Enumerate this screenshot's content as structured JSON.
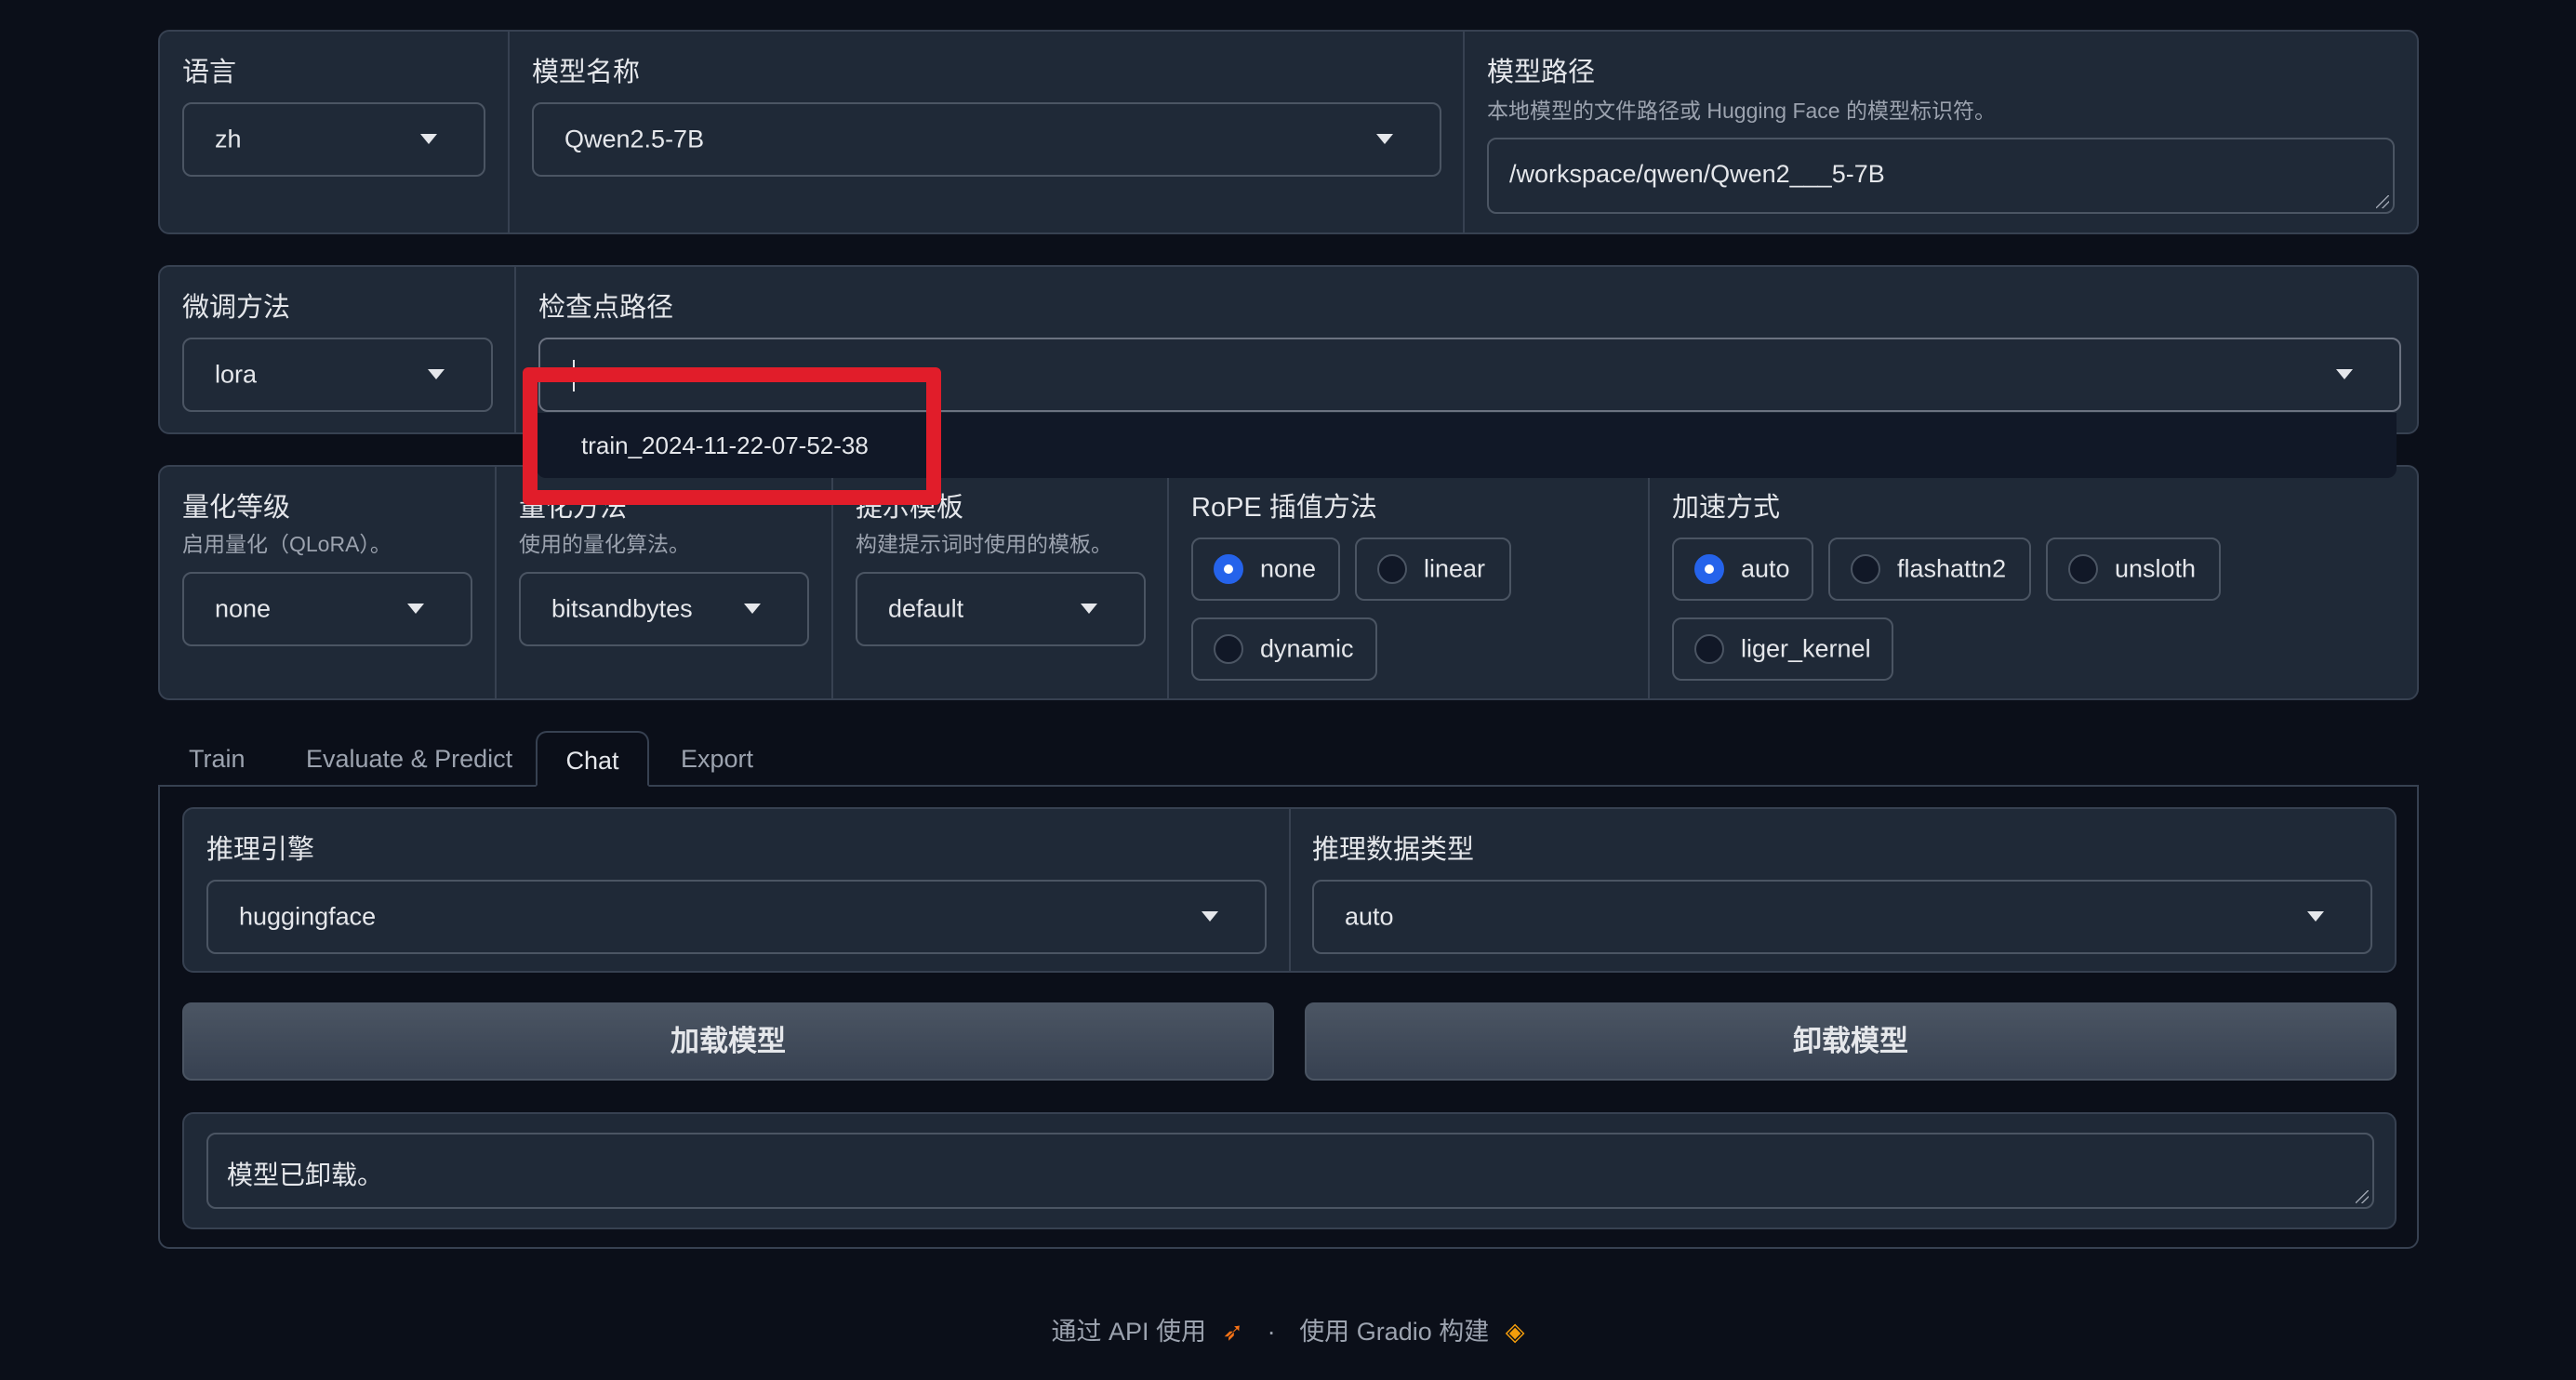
{
  "row1": {
    "lang": {
      "label": "语言",
      "value": "zh"
    },
    "model_name": {
      "label": "模型名称",
      "value": "Qwen2.5-7B"
    },
    "model_path": {
      "label": "模型路径",
      "info": "本地模型的文件路径或 Hugging Face 的模型标识符。",
      "value": "/workspace/qwen/Qwen2___5-7B"
    }
  },
  "row2": {
    "finetune": {
      "label": "微调方法",
      "value": "lora"
    },
    "checkpoint": {
      "label": "检查点路径",
      "value": "",
      "options": [
        "train_2024-11-22-07-52-38"
      ]
    }
  },
  "row3": {
    "quant_bit": {
      "label": "量化等级",
      "info": "启用量化（QLoRA）。",
      "value": "none"
    },
    "quant_method": {
      "label": "量化方法",
      "info": "使用的量化算法。",
      "value": "bitsandbytes"
    },
    "template": {
      "label": "提示模板",
      "info": "构建提示词时使用的模板。",
      "value": "default"
    },
    "rope": {
      "label": "RoPE 插值方法",
      "options": [
        "none",
        "linear",
        "dynamic"
      ],
      "selected": "none"
    },
    "booster": {
      "label": "加速方式",
      "options": [
        "auto",
        "flashattn2",
        "unsloth",
        "liger_kernel"
      ],
      "selected": "auto"
    }
  },
  "tabs": [
    "Train",
    "Evaluate & Predict",
    "Chat",
    "Export"
  ],
  "active_tab": "Chat",
  "chat": {
    "infer_backend": {
      "label": "推理引擎",
      "value": "huggingface"
    },
    "infer_dtype": {
      "label": "推理数据类型",
      "value": "auto"
    },
    "load_btn": "加载模型",
    "unload_btn": "卸载模型",
    "info_box": "模型已卸载。"
  },
  "footer": {
    "api": "通过 API 使用",
    "sep": "·",
    "built": "使用 Gradio 构建"
  },
  "colors": {
    "background": "#0b0f19",
    "panel": "#1f2937",
    "border": "#374151",
    "radio_selected": "#2563eb",
    "highlight_box": "#e11d2a"
  }
}
